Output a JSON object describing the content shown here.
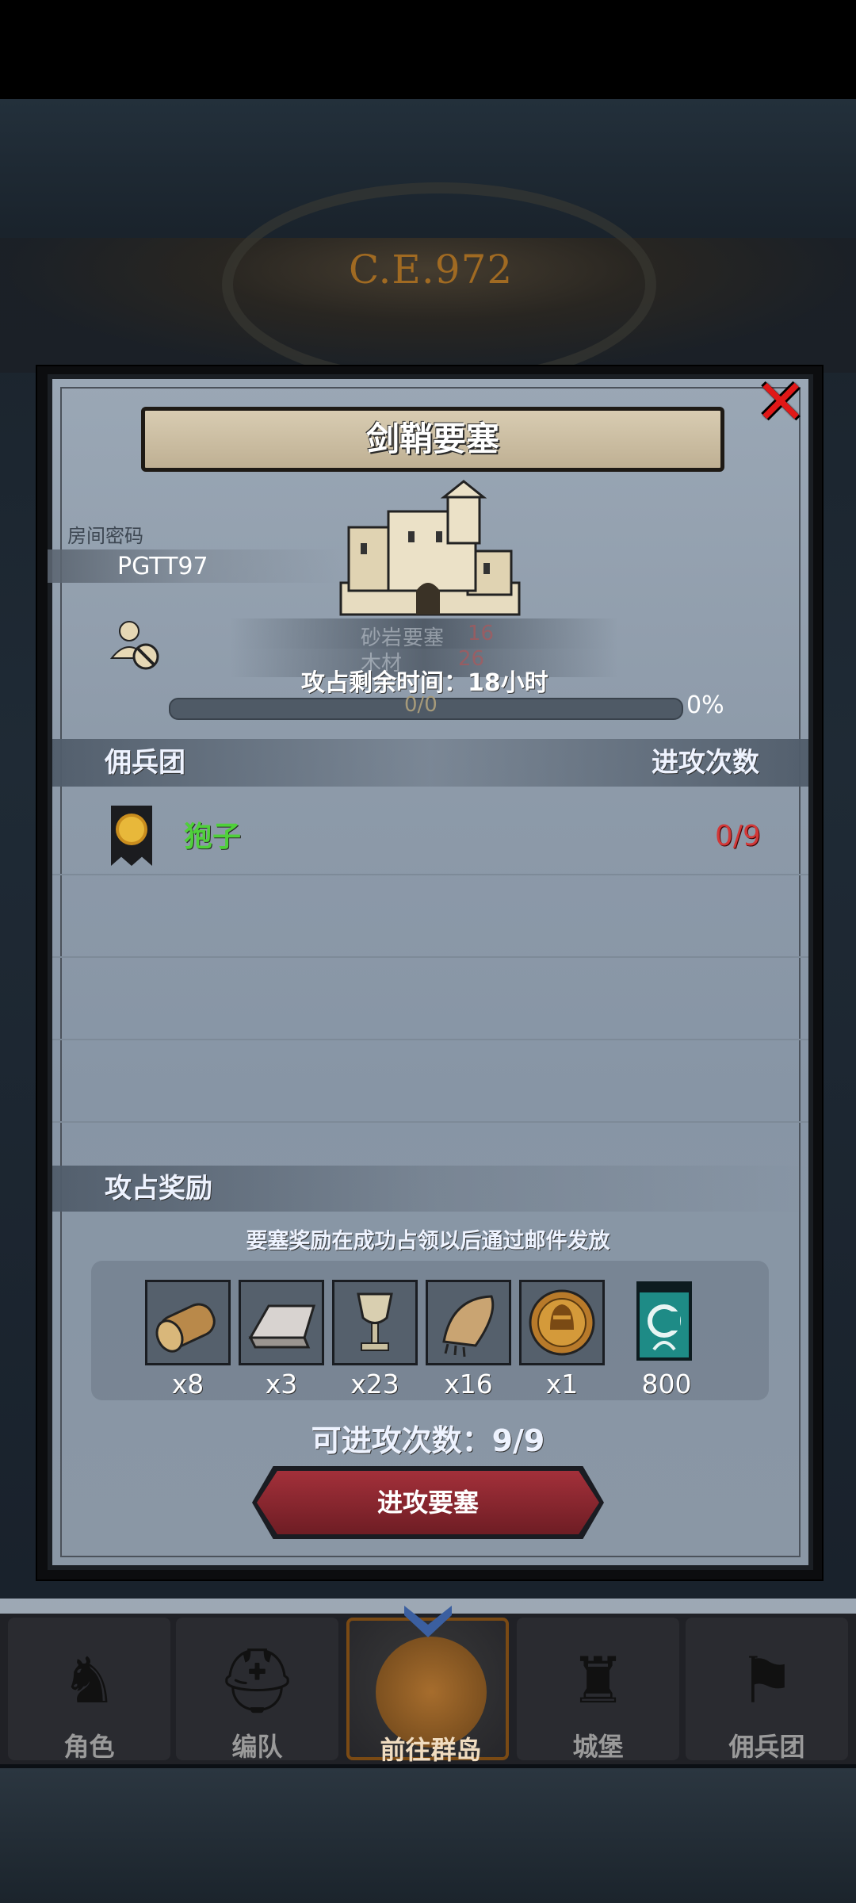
{
  "era_label": "C.E.972",
  "modal": {
    "title": "剑鞘要塞",
    "room_code_label": "房间密码",
    "room_code": "PGTT97",
    "ghost_line1": "砂岩",
    "ghost_line1b": "要塞",
    "ghost_line2": "木材",
    "ghost_red1": "16",
    "ghost_red2": "26",
    "time_remaining": "攻占剩余时间：18小时",
    "progress_text": "0/0",
    "progress_percent": "0%",
    "mercenary_header": "佣兵团",
    "attacks_header": "进攻次数",
    "mercenaries": [
      {
        "name": "狍子",
        "count": "0/9"
      }
    ],
    "reward_title": "攻占奖励",
    "reward_note": "要塞奖励在成功占领以后通过邮件发放",
    "rewards": [
      {
        "icon": "wood-log-icon",
        "qty": "x8"
      },
      {
        "icon": "iron-ingot-icon",
        "qty": "x3"
      },
      {
        "icon": "goblet-icon",
        "qty": "x23"
      },
      {
        "icon": "fur-pelt-icon",
        "qty": "x16"
      },
      {
        "icon": "knight-medal-icon",
        "qty": "x1"
      },
      {
        "icon": "banner-icon",
        "qty": "800"
      }
    ],
    "attack_count": "可进攻次数：9/9",
    "attack_button": "进攻要塞"
  },
  "nav": {
    "tabs": [
      {
        "label": "角色"
      },
      {
        "label": "编队"
      },
      {
        "label": "前往群岛"
      },
      {
        "label": "城堡"
      },
      {
        "label": "佣兵团"
      }
    ]
  },
  "colors": {
    "close": "#e01818",
    "merc_name": "#4fd03a",
    "merc_count": "#d23838",
    "button": "#a3303a"
  }
}
